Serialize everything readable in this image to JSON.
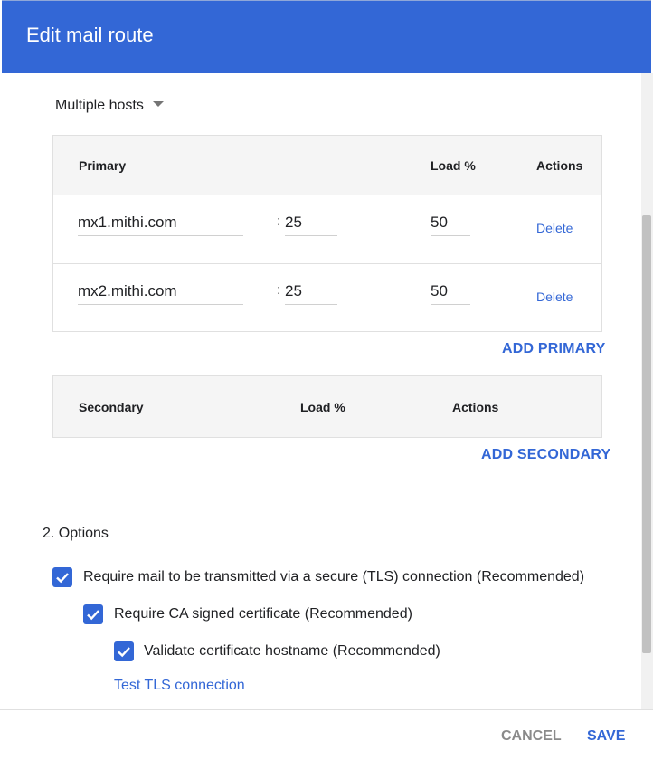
{
  "dialog": {
    "title": "Edit mail route"
  },
  "routing": {
    "mode_label": "Multiple hosts"
  },
  "primary_table": {
    "headers": {
      "host": "Primary",
      "load": "Load %",
      "actions": "Actions"
    },
    "rows": [
      {
        "host": "mx1.mithi.com",
        "sep": ":",
        "port": "25",
        "load": "50",
        "delete": "Delete"
      },
      {
        "host": "mx2.mithi.com",
        "sep": ":",
        "port": "25",
        "load": "50",
        "delete": "Delete"
      }
    ],
    "add_label": "ADD PRIMARY"
  },
  "secondary_table": {
    "headers": {
      "host": "Secondary",
      "load": "Load %",
      "actions": "Actions"
    },
    "add_label": "ADD SECONDARY"
  },
  "options": {
    "title": "2. Options",
    "tls_required": {
      "label": "Require mail to be transmitted via a secure (TLS) connection (Recommended)",
      "checked": true
    },
    "ca_signed": {
      "label": "Require CA signed certificate (Recommended)",
      "checked": true
    },
    "validate_hostname": {
      "label": "Validate certificate hostname (Recommended)",
      "checked": true
    },
    "test_link": "Test TLS connection"
  },
  "footer": {
    "cancel": "CANCEL",
    "save": "SAVE"
  },
  "colors": {
    "accent": "#3367d6",
    "header_bg": "#3367d6",
    "muted_button": "#8a8a8a"
  },
  "icons": {
    "dropdown": "caret-down-icon",
    "checkbox": "checkmark-icon"
  }
}
